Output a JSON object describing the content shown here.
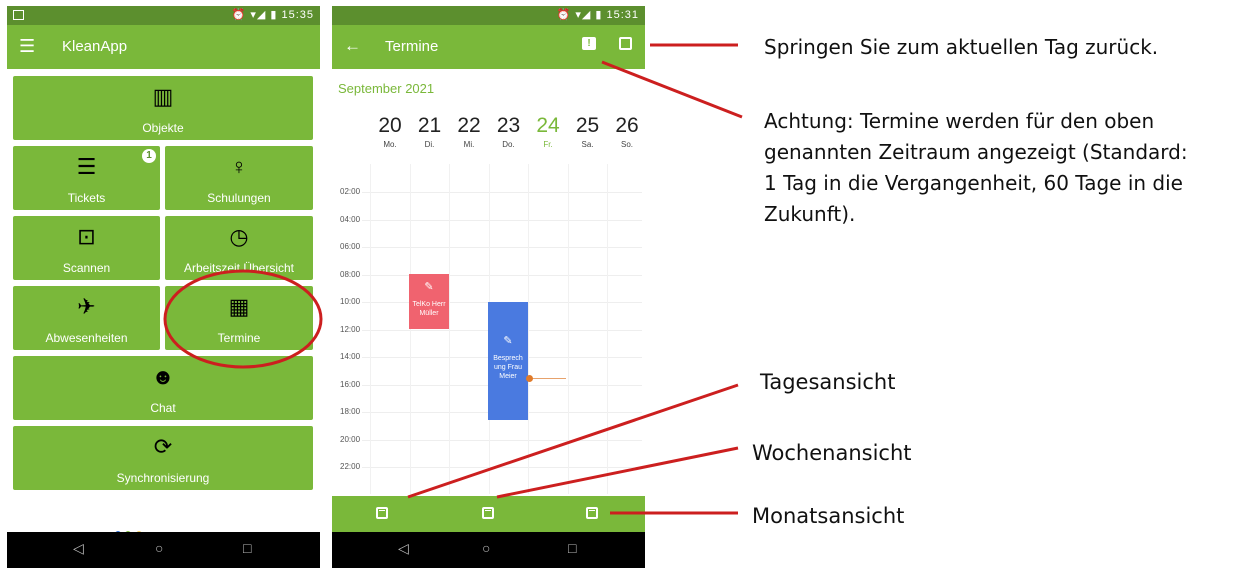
{
  "phone_left": {
    "status_time": "15:35",
    "app_title": "KleanApp",
    "tiles": [
      {
        "label": "Objekte",
        "icon": "building-icon"
      },
      {
        "label": "Tickets",
        "icon": "list-icon",
        "badge": "1"
      },
      {
        "label": "Schulungen",
        "icon": "lightbulb-icon"
      },
      {
        "label": "Scannen",
        "icon": "cast-icon"
      },
      {
        "label": "Arbeitszeit Übersicht",
        "icon": "clock-icon"
      },
      {
        "label": "Abwesenheiten",
        "icon": "flight-icon"
      },
      {
        "label": "Termine",
        "icon": "calendar-icon"
      },
      {
        "label": "Chat",
        "icon": "group-icon"
      },
      {
        "label": "Synchronisierung",
        "icon": "sync-icon"
      }
    ]
  },
  "phone_right": {
    "status_time": "15:31",
    "title": "Termine",
    "month": "September 2021",
    "days": [
      {
        "num": "20",
        "name": "Mo."
      },
      {
        "num": "21",
        "name": "Di."
      },
      {
        "num": "22",
        "name": "Mi."
      },
      {
        "num": "23",
        "name": "Do."
      },
      {
        "num": "24",
        "name": "Fr.",
        "today": true
      },
      {
        "num": "25",
        "name": "Sa."
      },
      {
        "num": "26",
        "name": "So."
      }
    ],
    "hours": [
      "02:00",
      "04:00",
      "06:00",
      "08:00",
      "10:00",
      "12:00",
      "14:00",
      "16:00",
      "18:00",
      "20:00",
      "22:00"
    ],
    "events": [
      {
        "text": "TelKo Herr Müller",
        "color": "#f0636f"
      },
      {
        "text": "Besprech ung Frau Meier",
        "color": "#4a7ae0"
      }
    ]
  },
  "annotations": {
    "today": "Springen Sie zum aktuellen Tag zurück.",
    "attention_lines": [
      "Achtung: Termine werden für den oben",
      "genannten Zeitraum angezeigt (Standard:",
      "1 Tag in die Vergangenheit, 60 Tage in die",
      "Zukunft)."
    ],
    "day_view": "Tagesansicht",
    "week_view": "Wochenansicht",
    "month_view": "Monatsansicht",
    "line_color": "#cc1f1f"
  }
}
